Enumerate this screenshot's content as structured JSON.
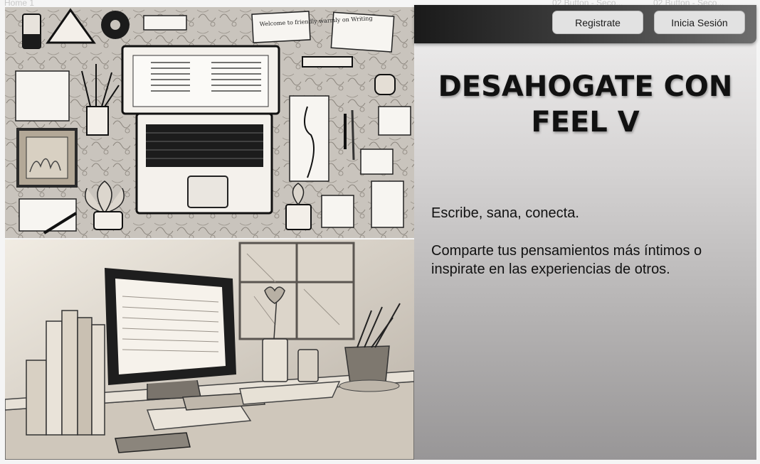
{
  "frame_labels": {
    "left": "Home 1",
    "button_a": "02 Button - Seco...",
    "button_b": "02 Button - Seco..."
  },
  "nav": {
    "register_label": "Registrate",
    "login_label": "Inicia Sesión"
  },
  "hero": {
    "title": "DESAHOGATE CON FEEL V",
    "tagline": "Escribe, sana, conecta.",
    "description": "Comparte tus pensamientos más íntimos o inspirate en las experiencias de otros."
  },
  "note_text": "Welcome to friendly warmly on Writing",
  "colors": {
    "topbar_dark": "#1a1a1a",
    "panel_gradient_top": "#f1f0f0",
    "panel_gradient_bottom": "#989697",
    "button_bg": "#e2e2e2"
  }
}
